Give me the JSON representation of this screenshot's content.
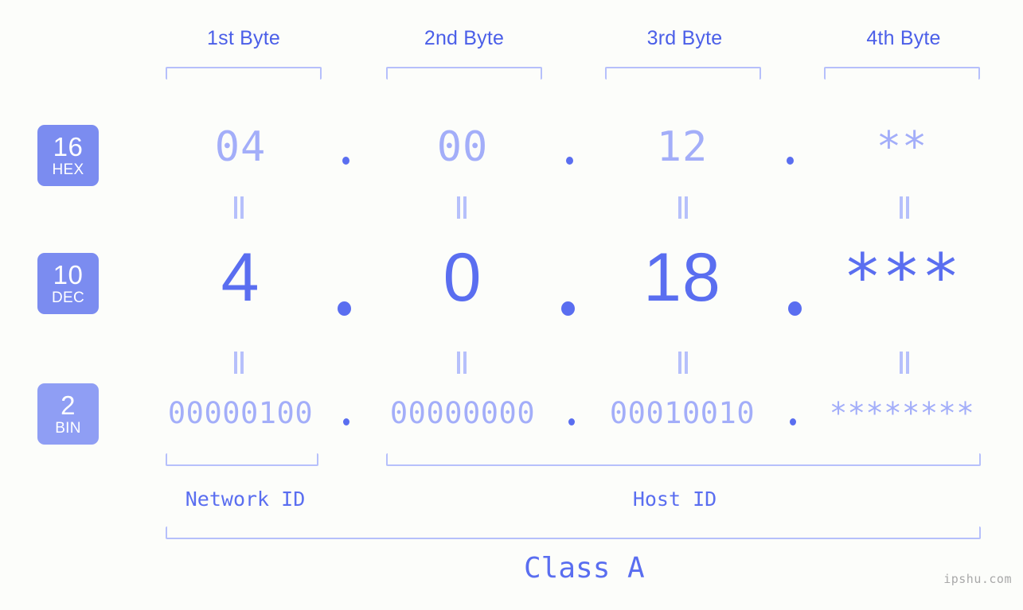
{
  "background_color": "#fcfdfa",
  "accent_color": "#5a6ef0",
  "light_accent_color": "#a3aef9",
  "bracket_color": "#b6c0fb",
  "badge_color": "#7b8cf0",
  "byte_headers": [
    {
      "label": "1st Byte"
    },
    {
      "label": "2nd Byte"
    },
    {
      "label": "3rd Byte"
    },
    {
      "label": "4th Byte"
    }
  ],
  "bases": [
    {
      "num": "16",
      "name": "HEX",
      "color": "#7b8cf0"
    },
    {
      "num": "10",
      "name": "DEC",
      "color": "#7b8cf0"
    },
    {
      "num": "2",
      "name": "BIN",
      "color": "#8f9ef4"
    }
  ],
  "rows": {
    "hex": {
      "base_num": "16",
      "base_name": "HEX",
      "values": [
        "04",
        "00",
        "12",
        "**"
      ]
    },
    "dec": {
      "base_num": "10",
      "base_name": "DEC",
      "values": [
        "4",
        "0",
        "18",
        "***"
      ]
    },
    "bin": {
      "base_num": "2",
      "base_name": "BIN",
      "values": [
        "00000100",
        "00000000",
        "00010010",
        "********"
      ]
    }
  },
  "separator": ".",
  "equality_symbol": "=",
  "segments": [
    {
      "label": "Network ID"
    },
    {
      "label": "Host ID"
    }
  ],
  "class_label": "Class A",
  "watermark": "ipshu.com"
}
